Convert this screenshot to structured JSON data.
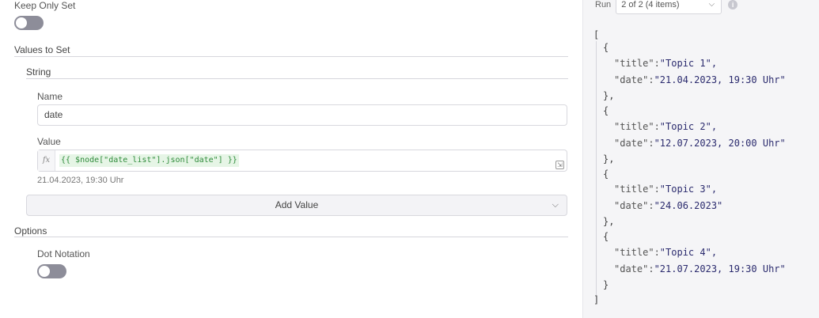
{
  "params": {
    "keep_only_set_label": "Keep Only Set",
    "values_to_set_title": "Values to Set",
    "string_title": "String",
    "name_label": "Name",
    "name_value": "date",
    "value_label": "Value",
    "fx_label": "fx",
    "value_expression": "{{ $node[\"date_list\"].json[\"date\"] }}",
    "value_preview": "21.04.2023, 19:30 Uhr",
    "add_value_label": "Add Value",
    "options_title": "Options",
    "dot_notation_label": "Dot Notation",
    "keep_only_set_on": false,
    "dot_notation_on": false
  },
  "output": {
    "run_label": "Run",
    "run_selected": "2 of 2 (4 items)",
    "items": [
      {
        "title": "Topic 1",
        "date": "21.04.2023, 19:30 Uhr"
      },
      {
        "title": "Topic 2",
        "date": "12.07.2023, 20:00 Uhr"
      },
      {
        "title": "Topic 3",
        "date": "24.06.2023"
      },
      {
        "title": "Topic 4",
        "date": "21.07.2023, 19:30 Uhr"
      }
    ],
    "open_bracket": "[",
    "close_bracket": "]",
    "open_brace": "{",
    "close_brace_comma": "},",
    "close_brace": "}",
    "title_key": "\"title\":",
    "date_key": "\"date\":",
    "title_values": [
      "\"Topic 1\",",
      "\"Topic 2\",",
      "\"Topic 3\",",
      "\"Topic 4\","
    ],
    "date_values": [
      "\"21.04.2023, 19:30 Uhr\"",
      "\"12.07.2023, 20:00 Uhr\"",
      "\"24.06.2023\"",
      "\"21.07.2023, 19:30 Uhr\""
    ]
  }
}
